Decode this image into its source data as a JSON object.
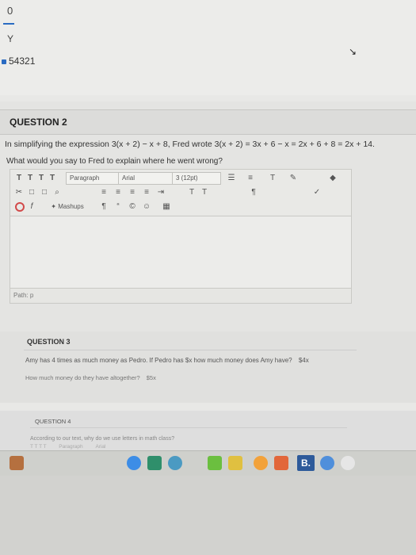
{
  "previous_answer": {
    "fraction_numerator": "0",
    "fraction_denominator": "Y",
    "value": "54321"
  },
  "question2": {
    "title": "QUESTION 2",
    "text_line1": "In simplifying the expression 3(x + 2) − x + 8, Fred wrote 3(x + 2) = 3x + 6 − x = 2x + 6 + 8 = 2x + 14.",
    "text_line2": "What would you say to Fred to explain where he went wrong?",
    "toolbar": {
      "style_buttons": [
        "T",
        "T",
        "T",
        "T"
      ],
      "paragraph_select": "Paragraph",
      "font_select": "Arial",
      "size_select": "3 (12pt)",
      "mashups_label": "Mashups"
    },
    "path_label": "Path: p"
  },
  "question3": {
    "title": "QUESTION 3",
    "text_line1": "Amy has 4 times as much money as Pedro. If Pedro has $x how much money does Amy have?",
    "answer1": "$4x",
    "text_line2": "How much money do they have altogether?",
    "answer2": "$5x"
  },
  "question4": {
    "title": "QUESTION 4",
    "text_line1": "According to our text, why do we use letters in math class?",
    "toolbar": {
      "paragraph_select": "Paragraph",
      "font_select": "Arial"
    }
  },
  "taskbar": {
    "b_icon_label": "B."
  },
  "colors": {
    "accent": "#2a6bc2",
    "alert": "#d24a4a"
  }
}
